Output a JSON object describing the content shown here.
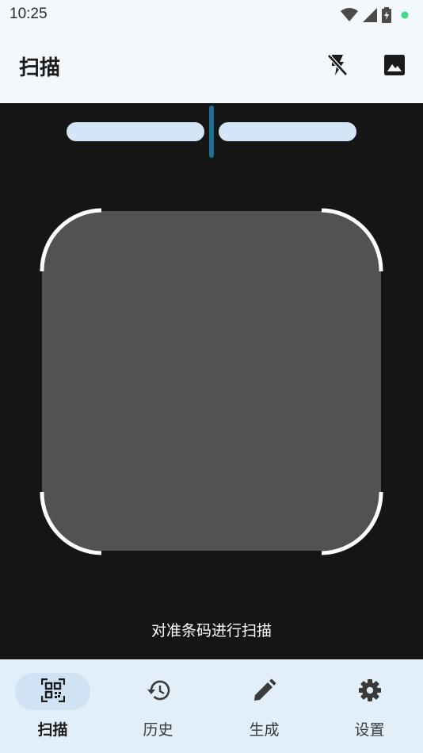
{
  "status_bar": {
    "time": "10:25",
    "icons": [
      "wifi-icon",
      "cellular-signal-icon",
      "battery-charging-icon",
      "notification-dot-icon"
    ],
    "dot_color": "#3ddc84"
  },
  "app_bar": {
    "title": "扫描",
    "actions": [
      "flash-off-icon",
      "gallery-image-icon"
    ]
  },
  "camera": {
    "zoom_level": 0.5,
    "hint": "对准条码进行扫描"
  },
  "bottom_nav": {
    "items": [
      {
        "label": "扫描",
        "icon": "qr-code-scan-icon",
        "active": true
      },
      {
        "label": "历史",
        "icon": "history-icon",
        "active": false
      },
      {
        "label": "生成",
        "icon": "pencil-edit-icon",
        "active": false
      },
      {
        "label": "设置",
        "icon": "gear-icon",
        "active": false
      }
    ]
  },
  "colors": {
    "accent": "#1e6f93",
    "surface": "#f3f8fd",
    "nav_bg": "#e2eef8",
    "camera_bg": "#151515"
  }
}
